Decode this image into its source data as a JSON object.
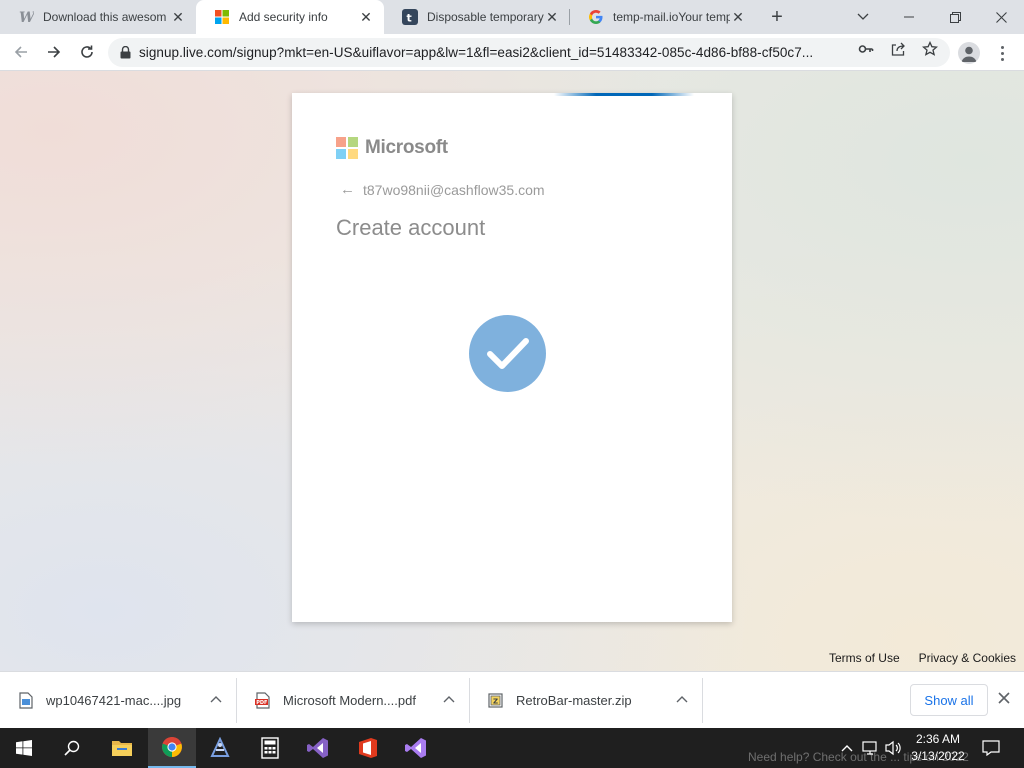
{
  "browser": {
    "tabs": [
      {
        "title": "Download this awesom",
        "icon": "w-logo-icon",
        "active": false
      },
      {
        "title": "Add security info",
        "icon": "microsoft-logo-icon",
        "active": true
      },
      {
        "title": "Disposable temporary",
        "icon": "t-logo-icon",
        "active": false
      },
      {
        "title": "temp-mail.ioYour temp",
        "icon": "google-icon",
        "active": false
      }
    ],
    "new_tab_symbol": "+",
    "url": "signup.live.com/signup?mkt=en-US&uiflavor=app&lw=1&fl=easi2&client_id=51483342-085c-4d86-bf88-cf50c7..."
  },
  "page": {
    "brand": "Microsoft",
    "email": "t87wo98nii@cashflow35.com",
    "heading": "Create account",
    "footer_links": [
      "Terms of Use",
      "Privacy & Cookies"
    ],
    "colors": {
      "check_circle": "#7fb1dd",
      "progress": "#0067b8"
    }
  },
  "downloads": {
    "items": [
      {
        "name": "wp10467421-mac....jpg",
        "icon": "image-file-icon"
      },
      {
        "name": "Microsoft Modern....pdf",
        "icon": "pdf-file-icon"
      },
      {
        "name": "RetroBar-master.zip",
        "icon": "zip-file-icon"
      }
    ],
    "show_all_label": "Show all"
  },
  "taskbar": {
    "apps": [
      "start-icon",
      "search-icon",
      "file-explorer-icon",
      "chrome-icon",
      "app-icon",
      "calculator-icon",
      "visual-studio-icon",
      "office-icon",
      "visual-studio-icon"
    ],
    "time": "2:36 AM",
    "date": "3/13/2022",
    "overlay_text": "Need help? Check out the ... tips on 2022"
  }
}
